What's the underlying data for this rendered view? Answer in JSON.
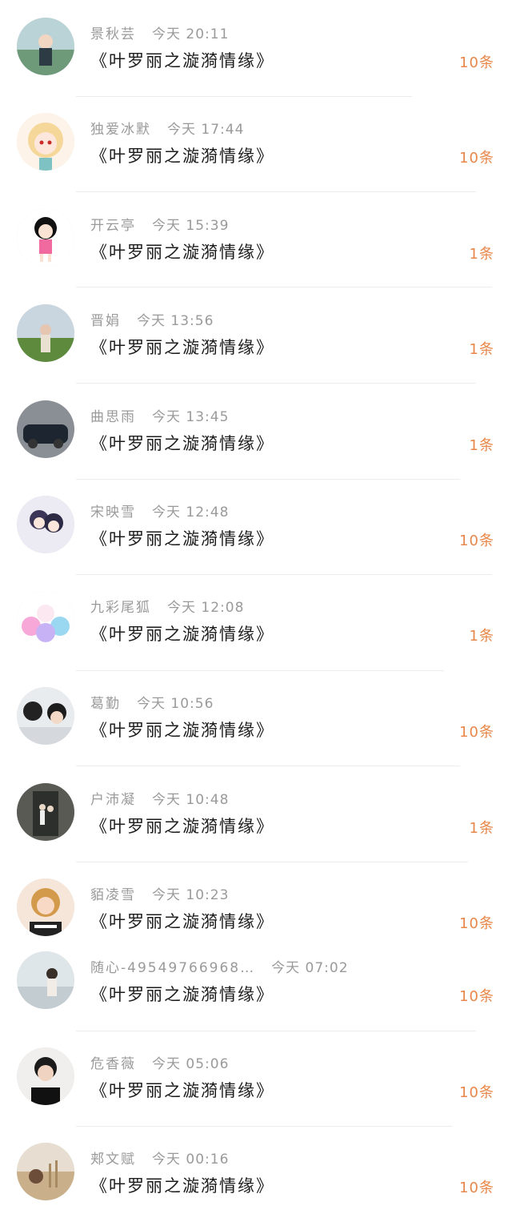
{
  "book_title": "《叶罗丽之漩漪情缘》",
  "colors": {
    "accent": "#e8874a",
    "meta": "#9a9a9a",
    "divider": "#ececec"
  },
  "messages": [
    {
      "name": "景秋芸",
      "day": "今天",
      "time": "20:11",
      "count": "10条",
      "avatar_icon": "avatar-landscape-girl"
    },
    {
      "name": "独爱冰默",
      "day": "今天",
      "time": "17:44",
      "count": "10条",
      "avatar_icon": "avatar-anime-blonde-girl"
    },
    {
      "name": "开云亭",
      "day": "今天",
      "time": "15:39",
      "count": "1条",
      "avatar_icon": "avatar-cartoon-girl"
    },
    {
      "name": "晋娟",
      "day": "今天",
      "time": "13:56",
      "count": "1条",
      "avatar_icon": "avatar-field-girl"
    },
    {
      "name": "曲思雨",
      "day": "今天",
      "time": "13:45",
      "count": "1条",
      "avatar_icon": "avatar-car"
    },
    {
      "name": "宋映雪",
      "day": "今天",
      "time": "12:48",
      "count": "10条",
      "avatar_icon": "avatar-anime-couple"
    },
    {
      "name": "九彩尾狐",
      "day": "今天",
      "time": "12:08",
      "count": "1条",
      "avatar_icon": "avatar-nine-tail-fox"
    },
    {
      "name": "葛勤",
      "day": "今天",
      "time": "10:56",
      "count": "10条",
      "avatar_icon": "avatar-boy-bear"
    },
    {
      "name": "户沛凝",
      "day": "今天",
      "time": "10:48",
      "count": "1条",
      "avatar_icon": "avatar-couple-door"
    },
    {
      "name": "貊凌雪",
      "day": "今天",
      "time": "10:23",
      "count": "10条",
      "avatar_icon": "avatar-blonde-woman"
    },
    {
      "name": "随心-49549766968…",
      "day": "今天",
      "time": "07:02",
      "count": "10条",
      "avatar_icon": "avatar-seaside-girl"
    },
    {
      "name": "危香薇",
      "day": "今天",
      "time": "05:06",
      "count": "10条",
      "avatar_icon": "avatar-man-portrait"
    },
    {
      "name": "郏文赋",
      "day": "今天",
      "time": "00:16",
      "count": "10条",
      "avatar_icon": "avatar-wheat-field"
    }
  ]
}
